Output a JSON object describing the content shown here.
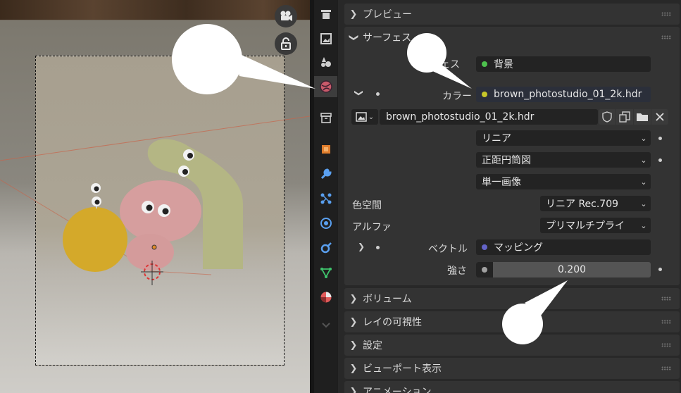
{
  "viewport": {
    "tools": [
      {
        "icon": "camera-icon"
      },
      {
        "icon": "lock-icon"
      }
    ]
  },
  "tabs": [
    {
      "icon": "render-icon",
      "active": false
    },
    {
      "icon": "output-icon",
      "active": false
    },
    {
      "icon": "view-layer-icon",
      "active": false
    },
    {
      "icon": "world-icon",
      "active": true
    },
    {
      "icon": "collection-icon",
      "active": false
    },
    {
      "icon": "object-icon",
      "active": false
    },
    {
      "icon": "modifier-wrench-icon",
      "active": false
    },
    {
      "icon": "particles-icon",
      "active": false
    },
    {
      "icon": "physics-icon",
      "active": false
    },
    {
      "icon": "constraints-icon",
      "active": false
    },
    {
      "icon": "data-icon",
      "active": false
    },
    {
      "icon": "material-icon",
      "active": false
    },
    {
      "icon": "chevron-down-icon",
      "active": false
    }
  ],
  "panels": {
    "preview": "プレビュー",
    "surface": "サーフェス",
    "volume": "ボリューム",
    "ray_visibility": "レイの可視性",
    "settings": "設定",
    "viewport_display": "ビューポート表示",
    "animation": "アニメーション"
  },
  "surface": {
    "surface_label": "ェス",
    "surface_value": "背景",
    "color_label": "カラー",
    "color_value": "brown_photostudio_01_2k.hdr",
    "image_name": "brown_photostudio_01_2k.hdr",
    "interpolation": "リニア",
    "projection": "正距円筒図",
    "source": "単一画像",
    "colorspace_label": "色空間",
    "colorspace_value": "リニア Rec.709",
    "alpha_label": "アルファ",
    "alpha_value": "プリマルチプライ",
    "vector_label": "ベクトル",
    "vector_value": "マッピング",
    "strength_label": "強さ",
    "strength_value": "0.200"
  },
  "colors": {
    "accent_active_tab": "#3d3d3d",
    "shader_green": "#4dc14d",
    "color_yellow": "#c7c729",
    "vector_purple": "#6363c7",
    "strength_gray": "#a1a1a1"
  }
}
